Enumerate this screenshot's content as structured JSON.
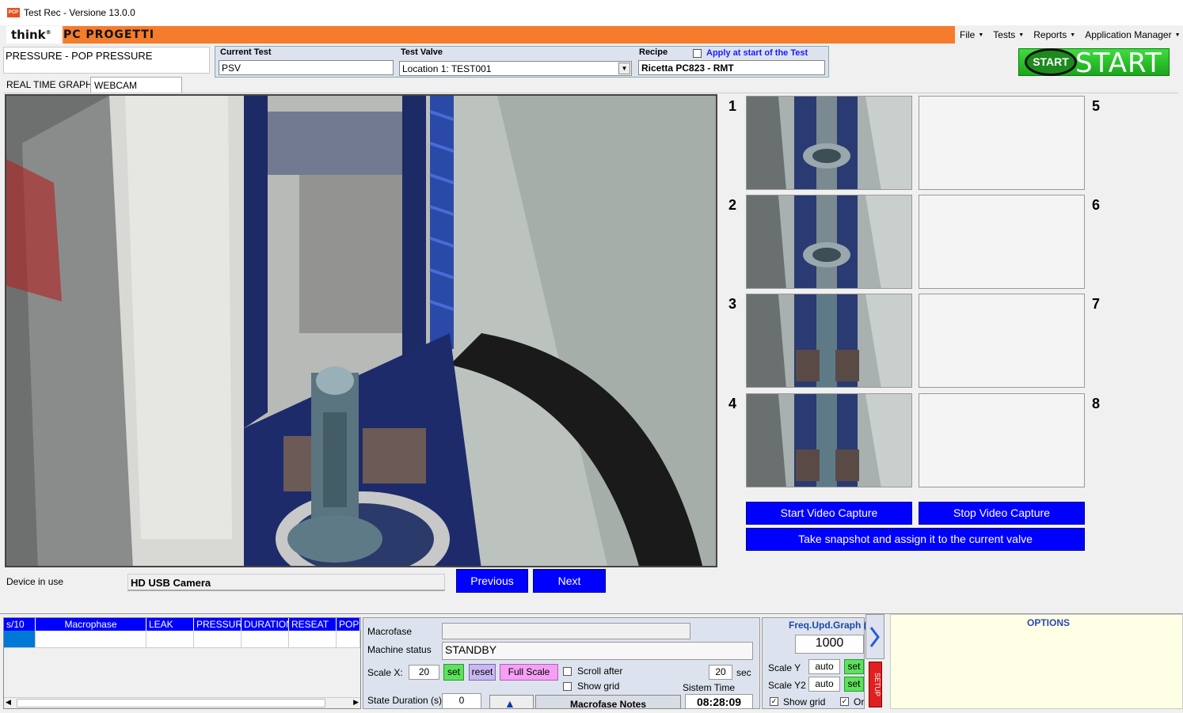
{
  "window": {
    "title": "Test Rec - Versione 13.0.0",
    "icon_label": "PCP"
  },
  "brand": {
    "think": "think",
    "reg": "®",
    "pc": "PC PROGETTI"
  },
  "menu": [
    {
      "label": "File"
    },
    {
      "label": "Tests"
    },
    {
      "label": "Reports"
    },
    {
      "label": "Application Manager"
    }
  ],
  "test_type": "PRESSURE - POP PRESSURE",
  "fields": {
    "current_test_label": "Current Test",
    "current_test_value": "PSV",
    "test_valve_label": "Test Valve",
    "test_valve_value": "Location 1:  TEST001",
    "recipe_label": "Recipe",
    "apply_label": "Apply at start of the Test",
    "recipe_value": "Ricetta PC823 - RMT"
  },
  "start": {
    "badge": "START",
    "label": "START"
  },
  "tabs": [
    {
      "label": "REAL TIME GRAPH"
    },
    {
      "label": "WEBCAM CONTROL"
    }
  ],
  "snapshots": {
    "numbers": [
      "1",
      "2",
      "3",
      "4",
      "5",
      "6",
      "7",
      "8"
    ]
  },
  "buttons": {
    "start_capture": "Start Video Capture",
    "stop_capture": "Stop Video Capture",
    "snapshot": "Take snapshot and assign it to the current valve",
    "previous": "Previous",
    "next": "Next"
  },
  "device": {
    "label": "Device in use",
    "value": "HD USB Camera"
  },
  "grid": {
    "columns": [
      "s/10",
      "Macrophase",
      "LEAK",
      "PRESSURE",
      "DURATION",
      "RESEAT",
      "POP"
    ]
  },
  "control": {
    "macrofase_label": "Macrofase",
    "machine_status_label": "Machine status",
    "machine_status_value": "STANDBY",
    "scale_x_label": "Scale X:",
    "scale_x_value": "20",
    "set": "set",
    "reset": "reset",
    "full_scale": "Full Scale",
    "scroll_after": "Scroll after",
    "scroll_value": "20",
    "sec": "sec",
    "show_grid": "Show grid",
    "sistem_time_label": "Sistem Time",
    "sistem_time_value": "08:28:09",
    "state_duration_label": "State Duration (s)",
    "state_duration_value": "0",
    "notes_label": "Macrofase Notes"
  },
  "freq": {
    "title": "Freq.Upd.Graph (",
    "value": "1000",
    "scale_y_label": "Scale Y",
    "scale_y_value": "auto",
    "scale_y2_label": "Scale Y2",
    "scale_y2_value": "auto",
    "set": "set",
    "show_grid": "Show grid",
    "or_label": "Or"
  },
  "side_tab": "SETUP",
  "options": {
    "title": "OPTIONS"
  },
  "colors": {
    "accent_orange": "#f47c2c",
    "action_blue": "#0000ff",
    "start_green": "#2ecc2e"
  }
}
